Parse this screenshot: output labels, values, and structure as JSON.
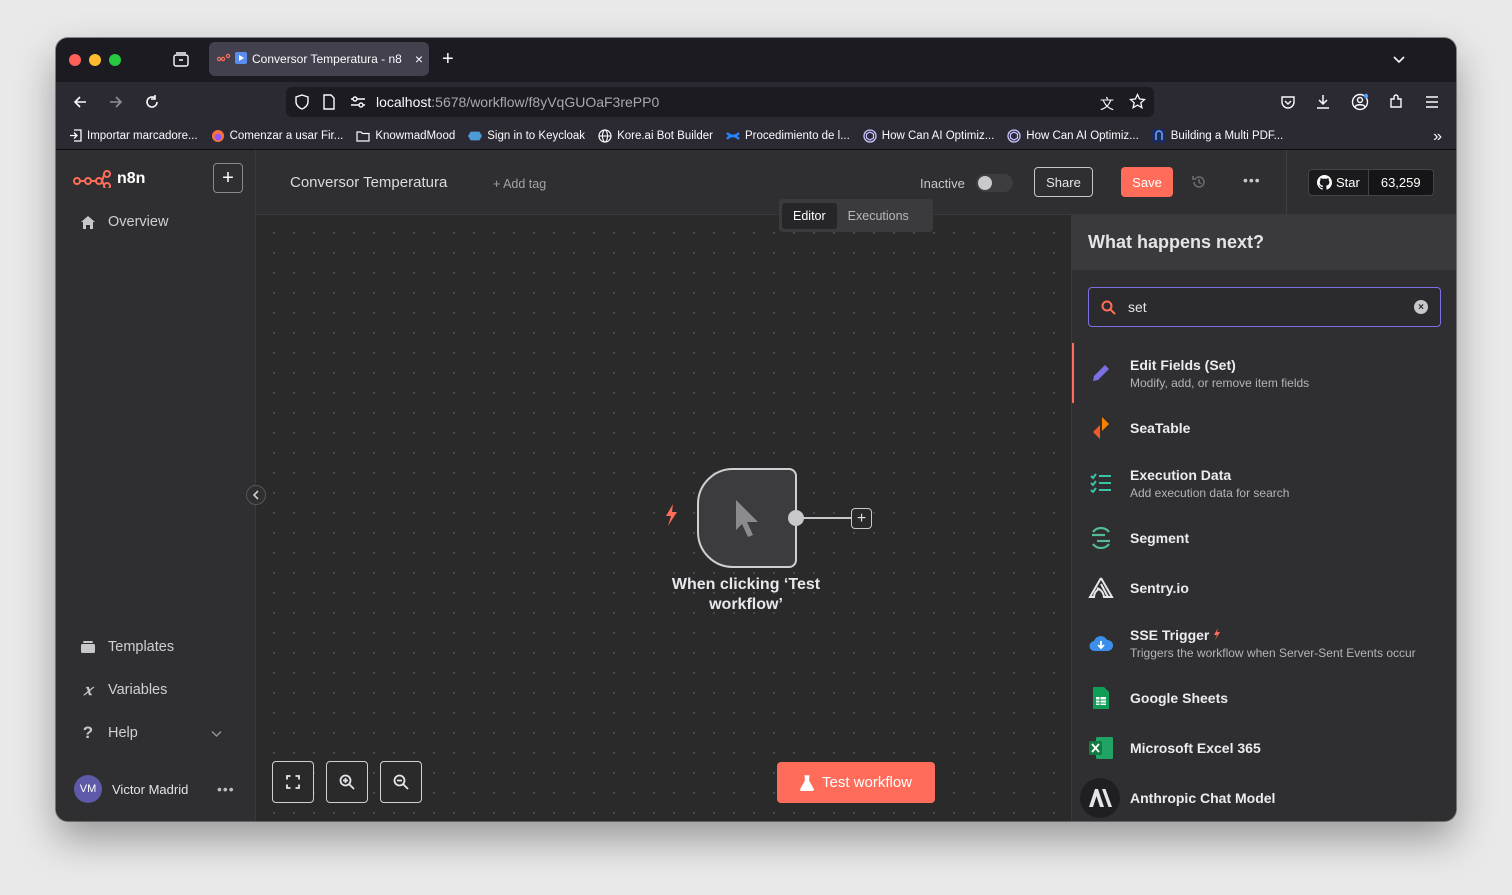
{
  "browser": {
    "tab_title": "Conversor Temperatura - n8",
    "url_host": "localhost",
    "url_path": ":5678/workflow/f8yVqGUOaF3rePP0",
    "bookmarks": [
      "Importar marcadore...",
      "Comenzar a usar Fir...",
      "KnowmadMood",
      "Sign in to Keycloak",
      "Kore.ai Bot Builder",
      "Procedimiento de l...",
      "How Can AI Optimiz...",
      "How Can AI Optimiz...",
      "Building a Multi PDF..."
    ]
  },
  "sidebar": {
    "logo": "n8n",
    "overview": "Overview",
    "templates": "Templates",
    "variables": "Variables",
    "help": "Help",
    "user_initials": "VM",
    "user_name": "Victor Madrid"
  },
  "header": {
    "workflow_name": "Conversor Temperatura",
    "add_tag": "+ Add tag",
    "status": "Inactive",
    "share": "Share",
    "save": "Save",
    "github_star": "Star",
    "github_count": "63,259",
    "tab_editor": "Editor",
    "tab_executions": "Executions"
  },
  "canvas": {
    "node_label": "When clicking ‘Test workflow’",
    "test_button": "Test workflow"
  },
  "panel": {
    "title": "What happens next?",
    "search_value": "set",
    "items": [
      {
        "name": "Edit Fields (Set)",
        "desc": "Modify, add, or remove item fields"
      },
      {
        "name": "SeaTable",
        "desc": ""
      },
      {
        "name": "Execution Data",
        "desc": "Add execution data for search"
      },
      {
        "name": "Segment",
        "desc": ""
      },
      {
        "name": "Sentry.io",
        "desc": ""
      },
      {
        "name": "SSE Trigger",
        "desc": "Triggers the workflow when Server-Sent Events occur"
      },
      {
        "name": "Google Sheets",
        "desc": ""
      },
      {
        "name": "Microsoft Excel 365",
        "desc": ""
      },
      {
        "name": "Anthropic Chat Model",
        "desc": ""
      }
    ]
  },
  "colors": {
    "accent": "#ff6d5a",
    "search_border": "#7b6fe6"
  }
}
